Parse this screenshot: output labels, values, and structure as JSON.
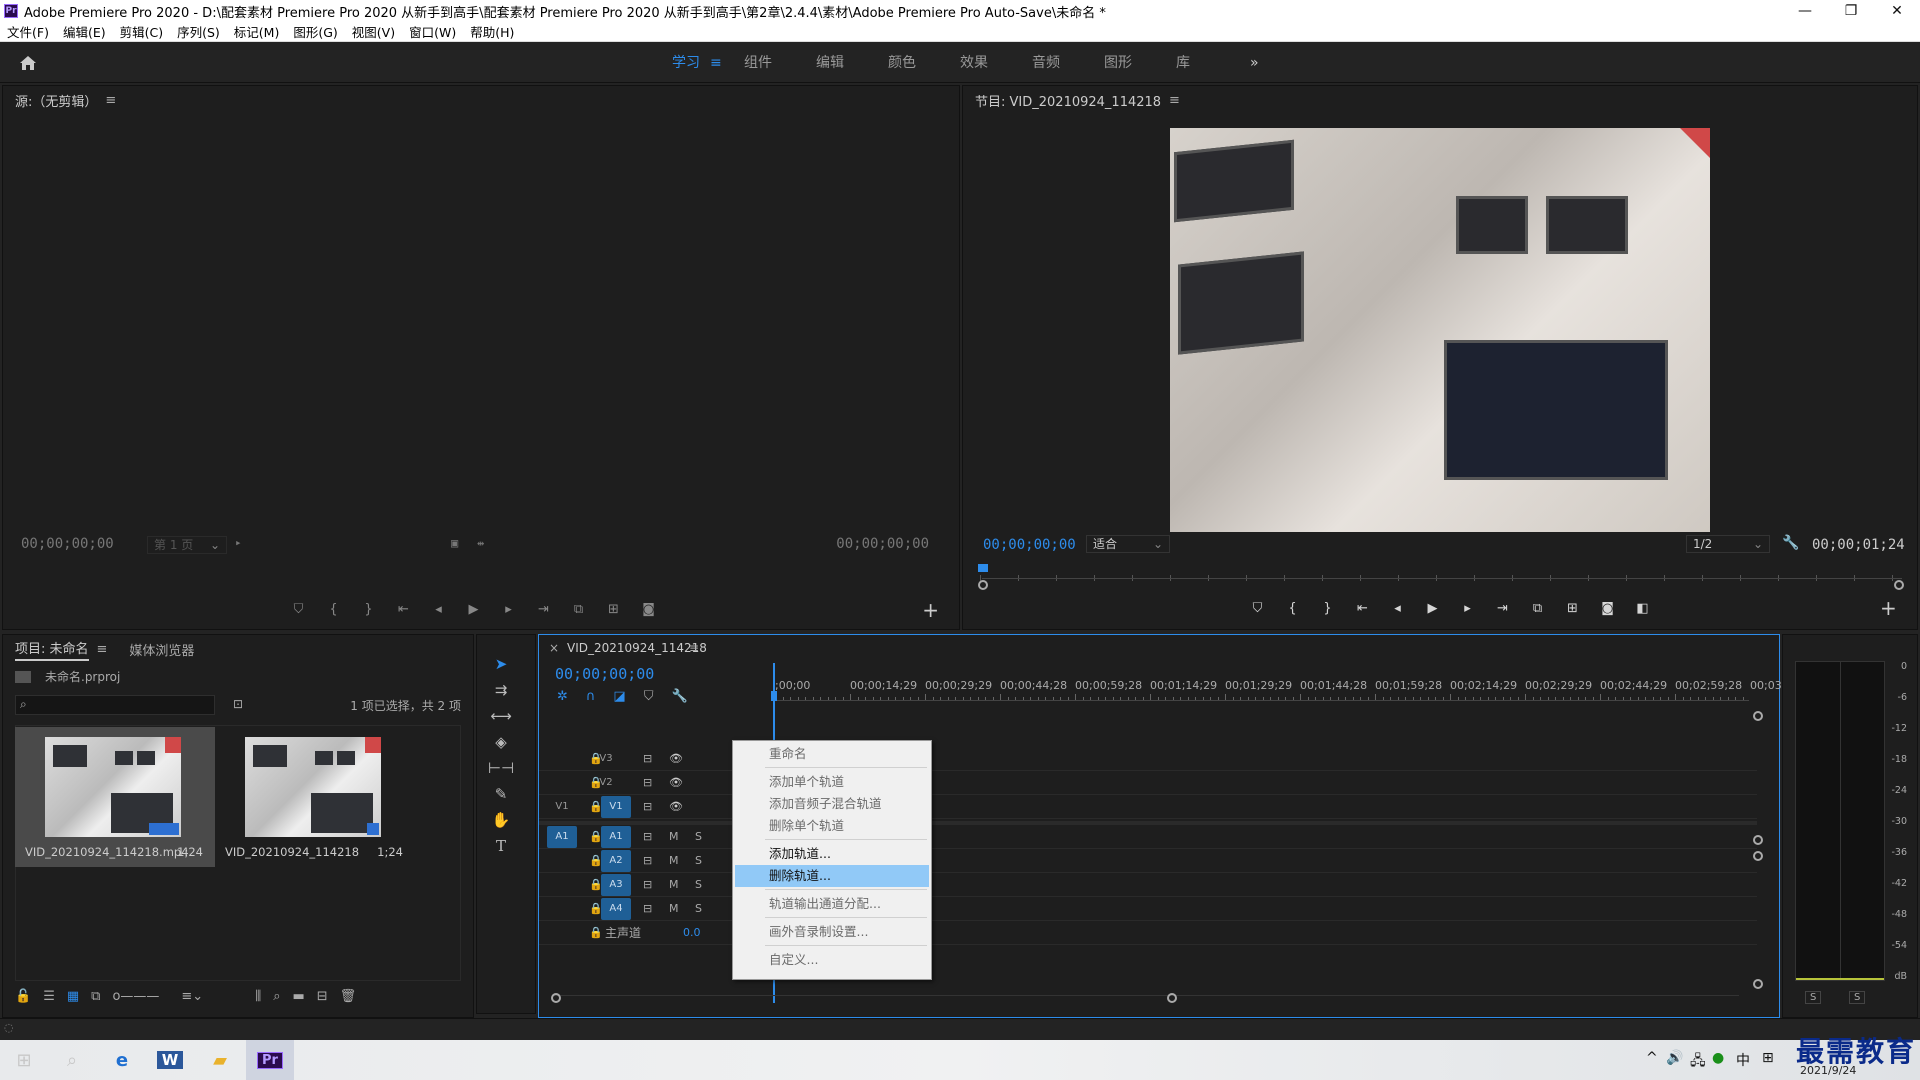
{
  "window": {
    "title": "Adobe Premiere Pro 2020 - D:\\配套素材 Premiere Pro 2020 从新手到高手\\配套素材 Premiere Pro 2020 从新手到高手\\第2章\\2.4.4\\素材\\Adobe Premiere Pro Auto-Save\\未命名 *",
    "app_logo": "Pr",
    "minimize": "—",
    "restore": "❐",
    "close": "✕"
  },
  "menu": [
    "文件(F)",
    "编辑(E)",
    "剪辑(C)",
    "序列(S)",
    "标记(M)",
    "图形(G)",
    "视图(V)",
    "窗口(W)",
    "帮助(H)"
  ],
  "workspaces": {
    "items": [
      "学习",
      "组件",
      "编辑",
      "颜色",
      "效果",
      "音频",
      "图形",
      "库"
    ],
    "active": "学习",
    "overflow": "»",
    "menu_icon": "≡"
  },
  "source_monitor": {
    "title": "源:（无剪辑）",
    "menu": "≡",
    "timecode_left": "00;00;00;00",
    "page_select": "第 1 页",
    "timecode_right": "00;00;00;00"
  },
  "program_monitor": {
    "title": "节目: VID_20210924_114218",
    "menu": "≡",
    "timecode": "00;00;00;00",
    "fit": "适合",
    "resolution": "1/2",
    "duration": "00;00;01;24"
  },
  "project": {
    "tab_project": "项目: 未命名",
    "tab_menu": "≡",
    "tab_media": "媒体浏览器",
    "file": "未命名.prproj",
    "selection_info": "1 项已选择，共 2 项",
    "search_placeholder": "",
    "items": [
      {
        "name": "VID_20210924_114218.mp4",
        "duration": "1;24"
      },
      {
        "name": "VID_20210924_114218",
        "duration": "1;24"
      }
    ]
  },
  "timeline": {
    "tab_title": "VID_20210924_114218",
    "tab_menu": "≡",
    "close": "×",
    "timecode": "00;00;00;00",
    "ruler": [
      ";00;00",
      "00;00;14;29",
      "00;00;29;29",
      "00;00;44;28",
      "00;00;59;28",
      "00;01;14;29",
      "00;01;29;29",
      "00;01;44;28",
      "00;01;59;28",
      "00;02;14;29",
      "00;02;29;29",
      "00;02;44;29",
      "00;02;59;28",
      "00;03;"
    ],
    "video_tracks": [
      "V3",
      "V2",
      "V1"
    ],
    "source_v": "V1",
    "audio_tracks": [
      "A1",
      "A2",
      "A3",
      "A4"
    ],
    "source_a": "A1",
    "mute": "M",
    "solo": "S",
    "master_label": "主声道",
    "master_value": "0.0"
  },
  "context_menu": {
    "items": [
      {
        "label": "重命名",
        "enabled": false
      },
      {
        "label": "添加单个轨道",
        "enabled": false
      },
      {
        "label": "添加音频子混合轨道",
        "enabled": false
      },
      {
        "label": "删除单个轨道",
        "enabled": false
      },
      {
        "label": "添加轨道...",
        "enabled": true
      },
      {
        "label": "删除轨道...",
        "enabled": true,
        "highlighted": true
      },
      {
        "label": "轨道输出通道分配...",
        "enabled": false
      },
      {
        "label": "画外音录制设置...",
        "enabled": false
      },
      {
        "label": "自定义...",
        "enabled": false
      }
    ]
  },
  "audio_meter": {
    "scale": [
      "0",
      "-6",
      "-12",
      "-18",
      "-24",
      "-30",
      "-36",
      "-42",
      "-48",
      "-54",
      "dB"
    ],
    "solo_left": "S",
    "solo_right": "S"
  },
  "taskbar": {
    "ime": "中",
    "date": "2021/9/24"
  },
  "watermark": "最需教育"
}
